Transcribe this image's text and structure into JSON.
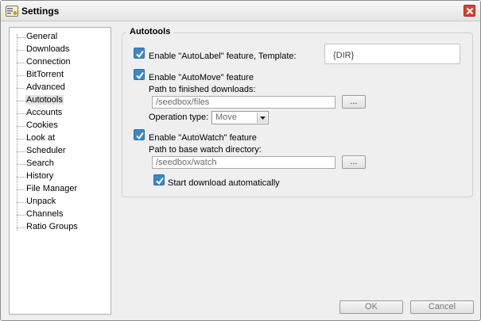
{
  "window": {
    "title": "Settings"
  },
  "sidebar": {
    "items": [
      {
        "label": "General"
      },
      {
        "label": "Downloads"
      },
      {
        "label": "Connection"
      },
      {
        "label": "BitTorrent"
      },
      {
        "label": "Advanced"
      },
      {
        "label": "Autotools",
        "selected": true
      },
      {
        "label": "Accounts"
      },
      {
        "label": "Cookies"
      },
      {
        "label": "Look at"
      },
      {
        "label": "Scheduler"
      },
      {
        "label": "Search"
      },
      {
        "label": "History"
      },
      {
        "label": "File Manager"
      },
      {
        "label": "Unpack"
      },
      {
        "label": "Channels"
      },
      {
        "label": "Ratio Groups"
      }
    ]
  },
  "autotools": {
    "group_title": "Autotools",
    "autolabel": {
      "checked": true,
      "label": "Enable \"AutoLabel\" feature, Template:",
      "template_value": "{DIR}"
    },
    "automove": {
      "checked": true,
      "label": "Enable \"AutoMove\" feature",
      "path_label": "Path to finished downloads:",
      "path_value": "/seedbox/files",
      "browse_label": "...",
      "operation_label": "Operation type:",
      "operation_value": "Move"
    },
    "autowatch": {
      "checked": true,
      "label": "Enable \"AutoWatch\" feature",
      "path_label": "Path to base watch directory:",
      "path_value": "/seedbox/watch",
      "browse_label": "...",
      "start_auto_checked": true,
      "start_auto_label": "Start download automatically"
    }
  },
  "footer": {
    "ok_label": "OK",
    "cancel_label": "Cancel"
  },
  "colors": {
    "checkbox": "#3b87c9",
    "close": "#d8442f"
  }
}
